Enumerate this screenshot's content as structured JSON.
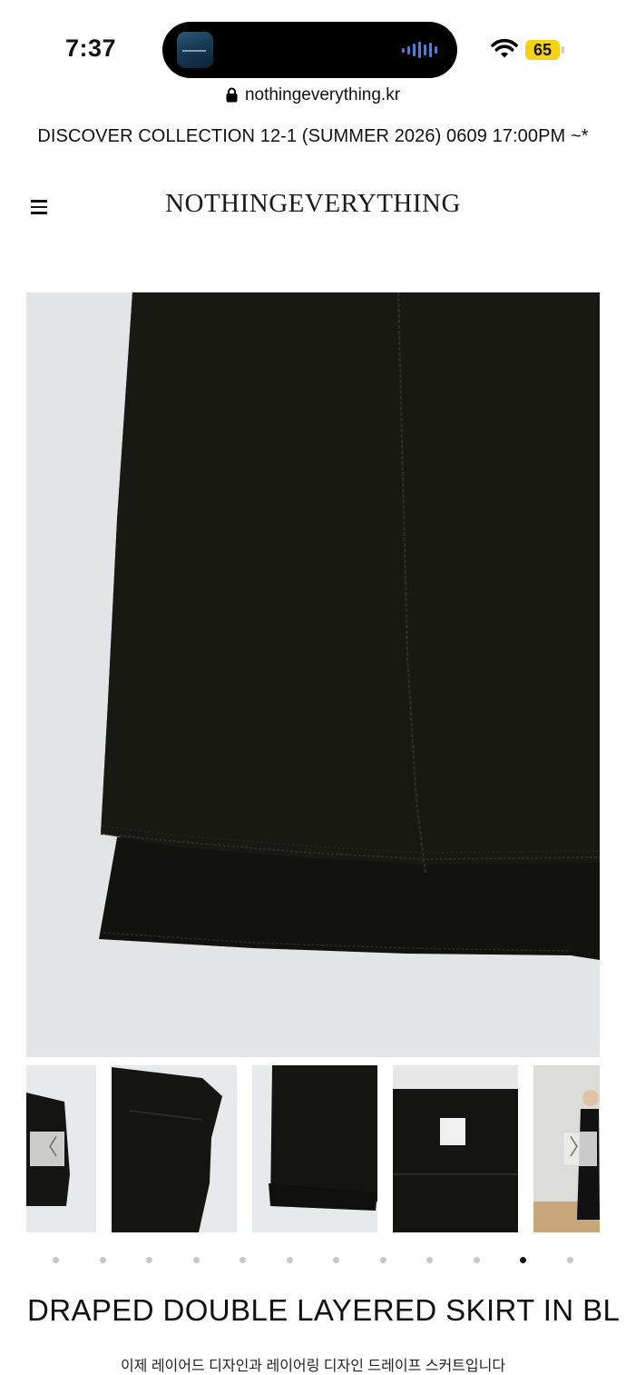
{
  "status_bar": {
    "time": "7:37",
    "battery": "65",
    "wifi_icon": "wifi-icon",
    "battery_color": "#f6d217"
  },
  "browser": {
    "url": "nothingeverything.kr",
    "lock_icon": "lock-icon"
  },
  "announcement": "DISCOVER COLLECTION 12-1 (SUMMER 2026) 0609 17:00PM ~*",
  "header": {
    "menu_icon": "hamburger-menu-icon",
    "brand": "NOTHINGEVERYTHING"
  },
  "gallery": {
    "prev_arrow": "〈",
    "next_arrow": "〉",
    "thumbnail_count": 5,
    "dot_count": 12,
    "active_dot": 11
  },
  "product": {
    "title": "DRAPED DOUBLE LAYERED SKIRT IN BL",
    "description": "이제 레이어드 디자인과 레이어링 디자인 드레이프 스커트입니다"
  }
}
